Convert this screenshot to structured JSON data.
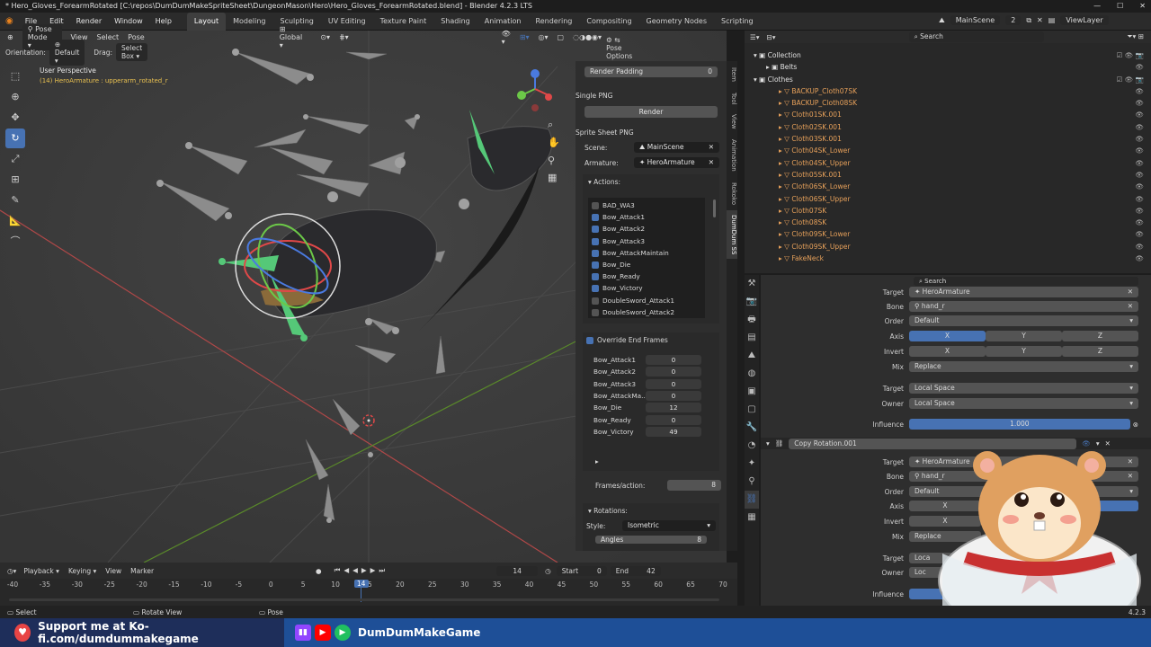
{
  "window": {
    "title": "* Hero_Gloves_ForearmRotated [C:\\repos\\DumDumMakeSpriteSheet\\DungeonMason\\Hero\\Hero_Gloves_ForearmRotated.blend] - Blender 4.2.3 LTS"
  },
  "menu": [
    "File",
    "Edit",
    "Render",
    "Window",
    "Help"
  ],
  "workspaces": [
    "Layout",
    "Modeling",
    "Sculpting",
    "UV Editing",
    "Texture Paint",
    "Shading",
    "Animation",
    "Rendering",
    "Compositing",
    "Geometry Nodes",
    "Scripting"
  ],
  "active_workspace": "Layout",
  "scene": {
    "name": "MainScene",
    "view_layer": "ViewLayer",
    "num": "2"
  },
  "viewport": {
    "mode": "Pose Mode",
    "menus": [
      "View",
      "Select",
      "Pose"
    ],
    "transform_orientation": "Global",
    "orientation_label": "Orientation:",
    "orientation_value": "Default",
    "drag_label": "Drag:",
    "drag_value": "Select Box",
    "perspective": "User Perspective",
    "object_info": "(14) HeroArmature : upperarm_rotated_r",
    "pose_options": "Pose Options"
  },
  "npanel": {
    "tabs": [
      "Item",
      "Tool",
      "View",
      "Animation",
      "Rokoko",
      "DumDum SS"
    ],
    "active_tab": "DumDum SS",
    "render_padding_label": "Render Padding",
    "render_padding_value": "0",
    "single_png": "Single PNG",
    "render_btn": "Render",
    "sprite_sheet_png": "Sprite Sheet PNG",
    "scene_label": "Scene:",
    "scene_value": "MainScene",
    "armature_label": "Armature:",
    "armature_value": "HeroArmature",
    "actions_title": "Actions:",
    "actions": [
      {
        "name": "BAD_WA3",
        "checked": false
      },
      {
        "name": "Bow_Attack1",
        "checked": true
      },
      {
        "name": "Bow_Attack2",
        "checked": true
      },
      {
        "name": "Bow_Attack3",
        "checked": true
      },
      {
        "name": "Bow_AttackMaintain",
        "checked": true
      },
      {
        "name": "Bow_Die",
        "checked": true
      },
      {
        "name": "Bow_Ready",
        "checked": true
      },
      {
        "name": "Bow_Victory",
        "checked": true
      },
      {
        "name": "DoubleSword_Attack1",
        "checked": false
      },
      {
        "name": "DoubleSword_Attack2",
        "checked": false
      }
    ],
    "override_end_frames": "Override End Frames",
    "end_frames": [
      {
        "name": "Bow_Attack1",
        "value": "0"
      },
      {
        "name": "Bow_Attack2",
        "value": "0"
      },
      {
        "name": "Bow_Attack3",
        "value": "0"
      },
      {
        "name": "Bow_AttackMa...",
        "value": "0"
      },
      {
        "name": "Bow_Die",
        "value": "12"
      },
      {
        "name": "Bow_Ready",
        "value": "0"
      },
      {
        "name": "Bow_Victory",
        "value": "49"
      }
    ],
    "frames_per_action_label": "Frames/action:",
    "frames_per_action_value": "8",
    "rotations_title": "Rotations:",
    "style_label": "Style:",
    "style_value": "Isometric",
    "angles_label": "Angles",
    "angles_value": "8"
  },
  "outliner": {
    "search_placeholder": "Search",
    "items": [
      {
        "name": "Collection",
        "level": 0
      },
      {
        "name": "Belts",
        "level": 1
      },
      {
        "name": "Clothes",
        "level": 0
      },
      {
        "name": "BACKUP_Cloth07SK",
        "level": 2
      },
      {
        "name": "BACKUP_Cloth08SK",
        "level": 2
      },
      {
        "name": "Cloth01SK.001",
        "level": 2
      },
      {
        "name": "Cloth02SK.001",
        "level": 2
      },
      {
        "name": "Cloth03SK.001",
        "level": 2
      },
      {
        "name": "Cloth04SK_Lower",
        "level": 2
      },
      {
        "name": "Cloth04SK_Upper",
        "level": 2
      },
      {
        "name": "Cloth05SK.001",
        "level": 2
      },
      {
        "name": "Cloth06SK_Lower",
        "level": 2
      },
      {
        "name": "Cloth06SK_Upper",
        "level": 2
      },
      {
        "name": "Cloth07SK",
        "level": 2
      },
      {
        "name": "Cloth08SK",
        "level": 2
      },
      {
        "name": "Cloth09SK_Lower",
        "level": 2
      },
      {
        "name": "Cloth09SK_Upper",
        "level": 2
      },
      {
        "name": "FakeNeck",
        "level": 2
      }
    ]
  },
  "properties": {
    "search_placeholder": "Search",
    "c1": {
      "target_label": "Target",
      "target_value": "HeroArmature",
      "bone_label": "Bone",
      "bone_value": "hand_r",
      "order_label": "Order",
      "order_value": "Default",
      "axis_label": "Axis",
      "invert_label": "Invert",
      "axes": [
        "X",
        "Y",
        "Z"
      ],
      "mix_label": "Mix",
      "mix_value": "Replace",
      "space_target_label": "Target",
      "space_target_value": "Local Space",
      "owner_label": "Owner",
      "owner_value": "Local Space",
      "influence_label": "Influence",
      "influence_value": "1.000"
    },
    "c2": {
      "name": "Copy Rotation.001",
      "target_label": "Target",
      "target_value": "HeroArmature",
      "bone_label": "Bone",
      "bone_value": "hand_r",
      "order_label": "Order",
      "order_value": "Default",
      "axis_label": "Axis",
      "invert_label": "Invert",
      "axis_x": "X",
      "invert_x": "X",
      "mix_label": "Mix",
      "mix_value": "Replace",
      "space_target_label": "Target",
      "space_target_value": "Loca",
      "owner_label": "Owner",
      "owner_value": "Loc",
      "influence_label": "Influence"
    }
  },
  "timeline": {
    "menus": [
      "Playback",
      "Keying",
      "View",
      "Marker"
    ],
    "current_frame": "14",
    "start_label": "Start",
    "start_value": "0",
    "end_label": "End",
    "end_value": "42",
    "ticks": [
      "-40",
      "-35",
      "-30",
      "-25",
      "-20",
      "-15",
      "-10",
      "-5",
      "0",
      "5",
      "10",
      "15",
      "20",
      "25",
      "30",
      "35",
      "40",
      "45",
      "50",
      "55",
      "60",
      "65",
      "70"
    ],
    "playhead": "14"
  },
  "statusbar": {
    "select": "Select",
    "rotate_view": "Rotate View",
    "pose": "Pose",
    "version": "4.2.3"
  },
  "footer": {
    "kofi": "Support me at Ko-fi.com/dumdummakegame",
    "channel": "DumDumMakeGame"
  },
  "colors": {
    "accent": "#4772b3",
    "footer_bg": "#1e4f97",
    "orange_text": "#e6a05a"
  }
}
